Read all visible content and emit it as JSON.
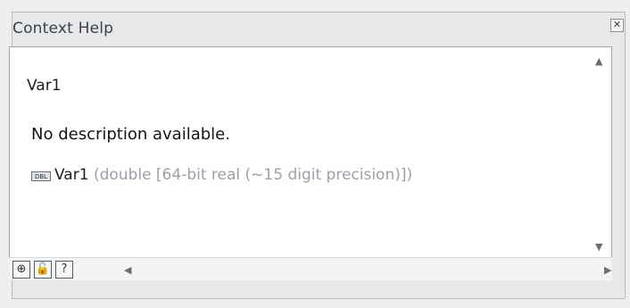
{
  "window": {
    "title": "Context Help",
    "close_icon": "close-icon"
  },
  "content": {
    "heading": "Var1",
    "description": "No description available.",
    "type_icon_label": "DBL",
    "type_name": "Var1",
    "type_detail": " (double [64-bit real (~15 digit precision)])"
  },
  "scrollbar": {
    "up_arrow": "▲",
    "down_arrow": "▼",
    "left_arrow": "◀",
    "right_arrow": "▶"
  },
  "toolbar": {
    "buttons": [
      {
        "name": "show-optional-terminals-button",
        "icon": "terminal-icon",
        "glyph": "⊕"
      },
      {
        "name": "lock-context-help-button",
        "icon": "lock-icon",
        "glyph": "🔓"
      },
      {
        "name": "detailed-help-button",
        "icon": "question-icon",
        "glyph": "?"
      }
    ]
  },
  "colors": {
    "title": "#3d4148",
    "window_bg": "#e6e8ea",
    "content_bg": "#ffffff",
    "detail_text": "#9ca0a6"
  }
}
